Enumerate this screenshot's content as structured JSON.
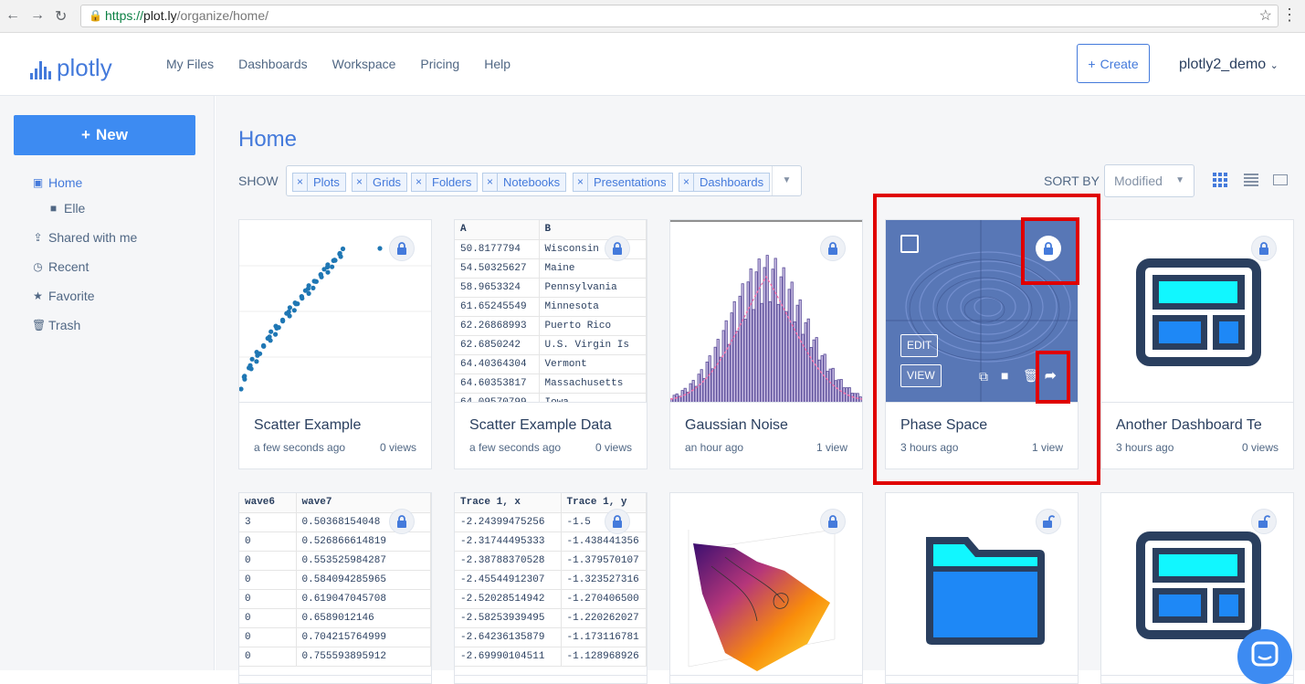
{
  "browser": {
    "url_secure": "https://",
    "url_host": "plot.ly",
    "url_path": "/organize/home/"
  },
  "header": {
    "logo_text": "plotly",
    "nav": [
      "My Files",
      "Dashboards",
      "Workspace",
      "Pricing",
      "Help"
    ],
    "create_label": "Create",
    "username": "plotly2_demo"
  },
  "sidebar": {
    "new_label": "New",
    "items": [
      {
        "label": "Home",
        "icon": "folder-open-icon"
      },
      {
        "label": "Elle",
        "icon": "folder-icon"
      },
      {
        "label": "Shared with me",
        "icon": "shared-icon"
      },
      {
        "label": "Recent",
        "icon": "clock-icon"
      },
      {
        "label": "Favorite",
        "icon": "star-icon"
      },
      {
        "label": "Trash",
        "icon": "trash-icon"
      }
    ]
  },
  "main": {
    "title": "Home",
    "show_label": "SHOW",
    "filters": [
      "Plots",
      "Grids",
      "Folders",
      "Notebooks",
      "Presentations",
      "Dashboards"
    ],
    "sort_label": "SORT BY",
    "sort_value": "Modified"
  },
  "cards": [
    {
      "title": "Scatter Example",
      "age": "a few seconds ago",
      "views": "0 views"
    },
    {
      "title": "Scatter Example Data",
      "age": "a few seconds ago",
      "views": "0 views"
    },
    {
      "title": "Gaussian Noise",
      "age": "an hour ago",
      "views": "1 view"
    },
    {
      "title": "Phase Space",
      "age": "3 hours ago",
      "views": "1 view",
      "edit_label": "EDIT",
      "view_label": "VIEW"
    },
    {
      "title": "Another Dashboard Te",
      "age": "3 hours ago",
      "views": "0 views"
    }
  ],
  "grid1": {
    "headers": [
      "A",
      "B"
    ],
    "rows": [
      [
        "50.8177794",
        "Wisconsin"
      ],
      [
        "54.50325627",
        "Maine"
      ],
      [
        "58.9653324",
        "Pennsylvania"
      ],
      [
        "61.65245549",
        "Minnesota"
      ],
      [
        "62.26868993",
        "Puerto Rico"
      ],
      [
        "62.6850242",
        "U.S. Virgin Is"
      ],
      [
        "64.40364304",
        "Vermont"
      ],
      [
        "64.60353817",
        "Massachusetts"
      ],
      [
        "64.09570799",
        "Iowa"
      ]
    ]
  },
  "grid2": {
    "headers": [
      "wave6",
      "wave7"
    ],
    "rows": [
      [
        "3",
        "0.50368154048"
      ],
      [
        "0",
        "0.526866614819"
      ],
      [
        "0",
        "0.553525984287"
      ],
      [
        "0",
        "0.584094285965"
      ],
      [
        "0",
        "0.619047045708"
      ],
      [
        "0",
        "0.6589012146"
      ],
      [
        "0",
        "0.704215764999"
      ],
      [
        "0",
        "0.755593895912"
      ]
    ]
  },
  "grid3": {
    "headers": [
      "Trace 1, x",
      "Trace 1, y"
    ],
    "rows": [
      [
        "-2.24399475256",
        "-1.5"
      ],
      [
        "-2.31744495333",
        "-1.438441356"
      ],
      [
        "-2.38788370528",
        "-1.379570107"
      ],
      [
        "-2.45544912307",
        "-1.323527316"
      ],
      [
        "-2.52028514942",
        "-1.270406500"
      ],
      [
        "-2.58253939495",
        "-1.220262027"
      ],
      [
        "-2.64236135879",
        "-1.173116781"
      ],
      [
        "-2.69990104511",
        "-1.128968926"
      ]
    ]
  },
  "colors": {
    "accent": "#447adb",
    "new_button": "#3d8bf2",
    "highlight": "#e00000",
    "dashboard_frame": "#2a3f5f",
    "dashboard_cyan": "#11f7ff",
    "dashboard_blue": "#1e88f6"
  }
}
